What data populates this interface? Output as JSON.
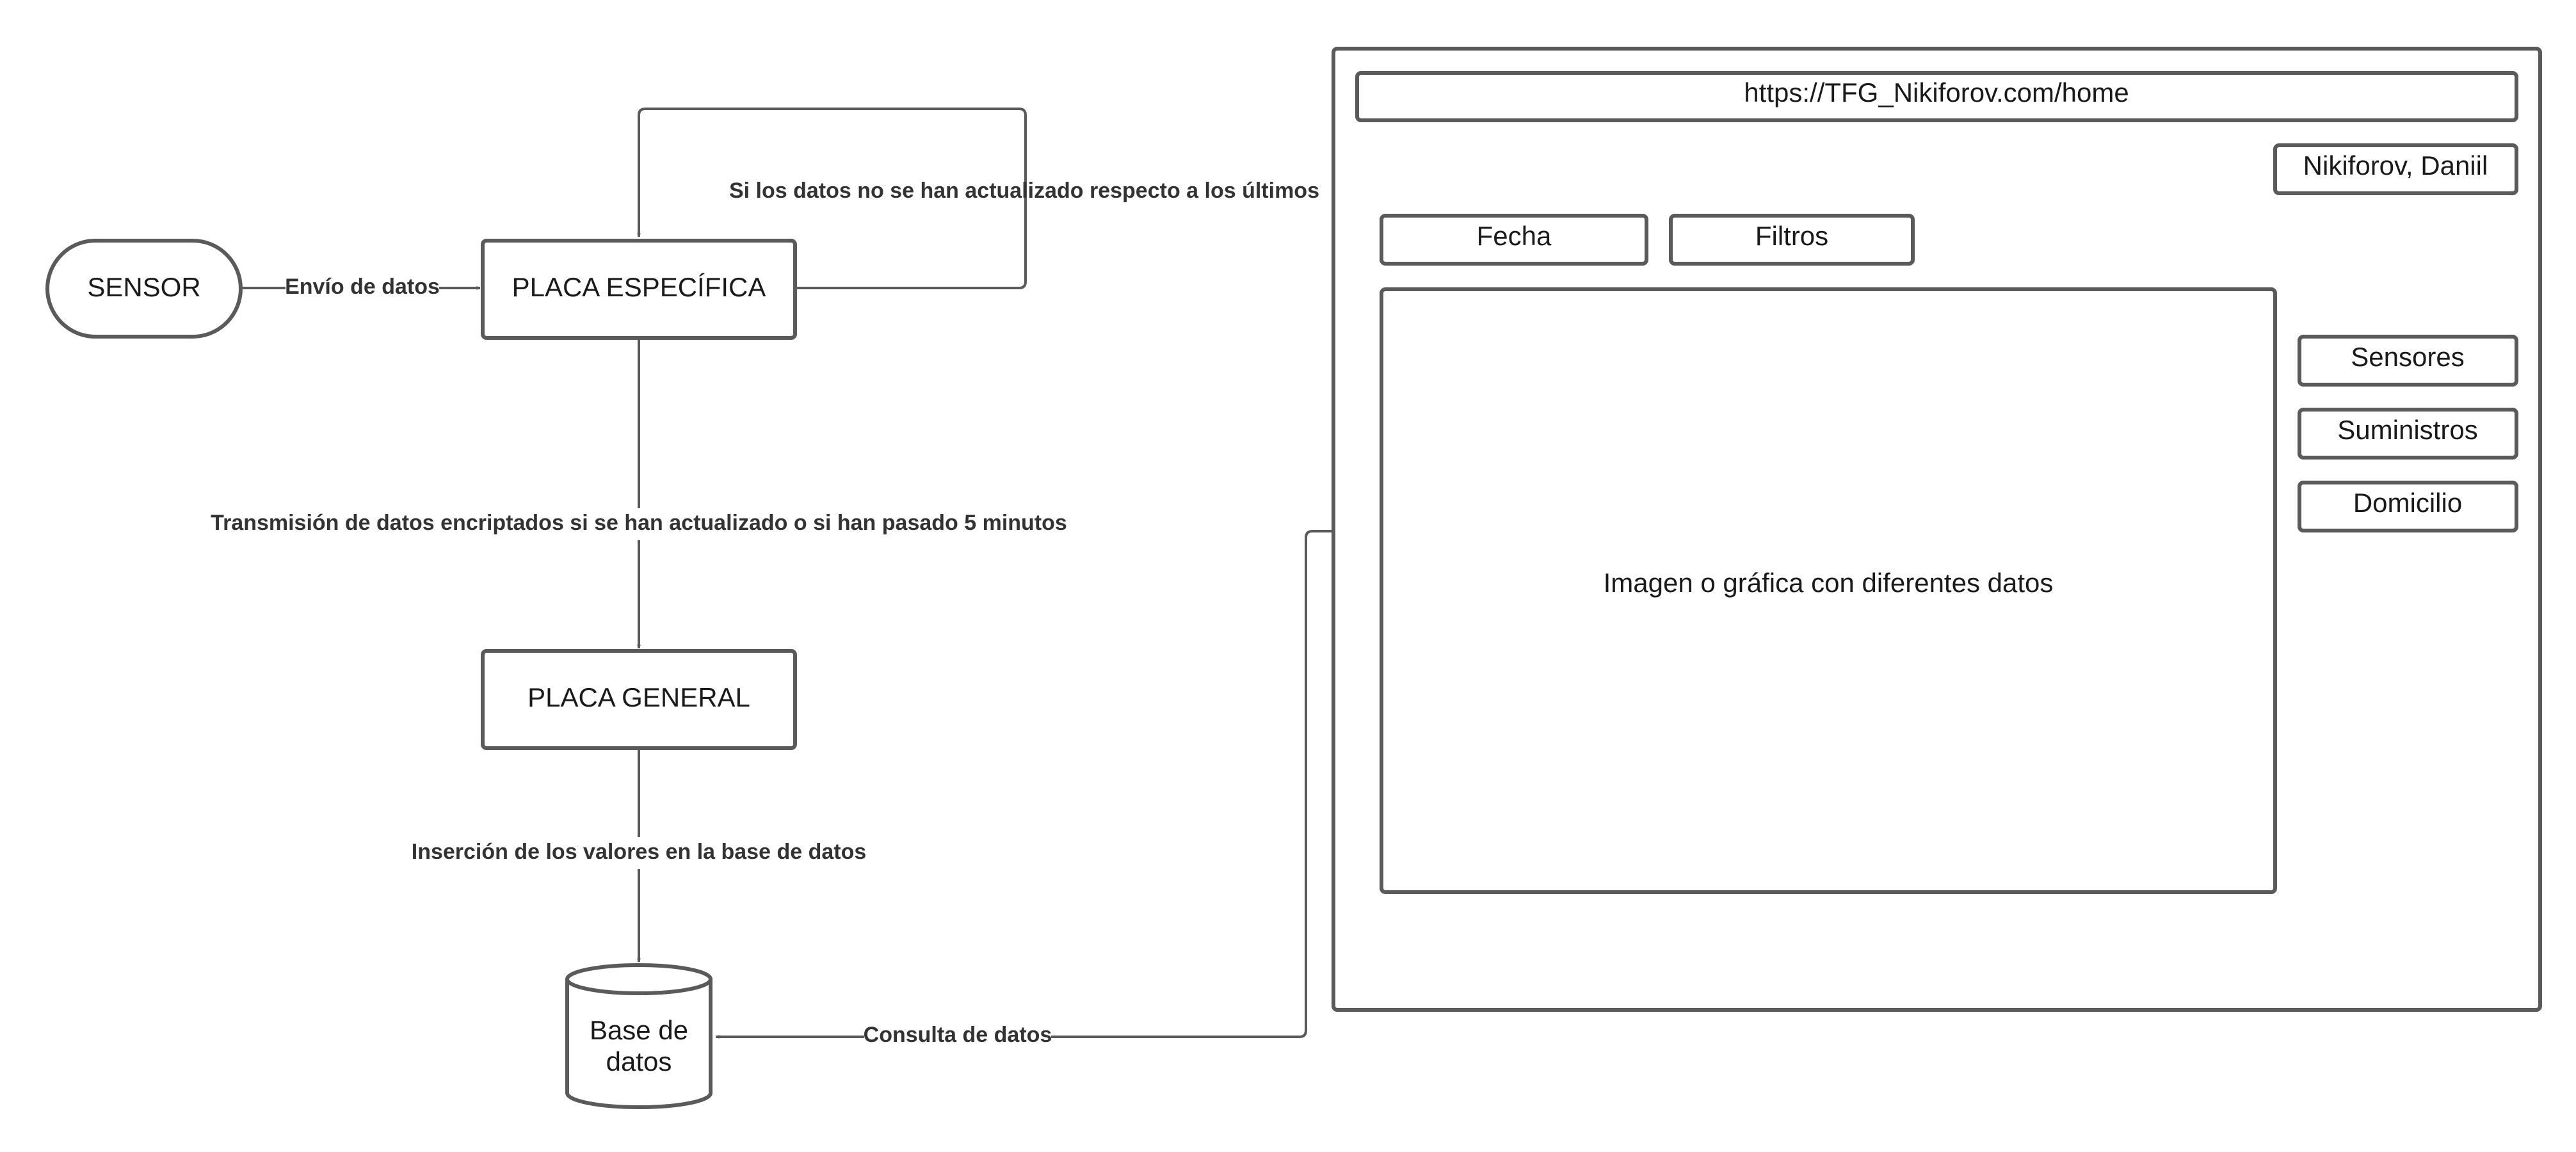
{
  "nodes": {
    "sensor": "SENSOR",
    "placa_especifica": "PLACA ESPECÍFICA",
    "placa_general": "PLACA GENERAL",
    "base_datos_line1": "Base de",
    "base_datos_line2": "datos"
  },
  "edges": {
    "envio": "Envío de datos",
    "loop": "Si los datos no se han actualizado respecto a los últimos",
    "transmision": "Transmisión de datos encriptados si se han actualizado o si han pasado 5 minutos",
    "insercion": "Inserción de los valores en la base de datos",
    "consulta": "Consulta de datos"
  },
  "mockup": {
    "url": "https://TFG_Nikiforov.com/home",
    "user": "Nikiforov, Daniil",
    "fecha": "Fecha",
    "filtros": "Filtros",
    "main_content": "Imagen o gráfica con diferentes datos",
    "sensores": "Sensores",
    "suministros": "Suministros",
    "domicilio": "Domicilio"
  }
}
